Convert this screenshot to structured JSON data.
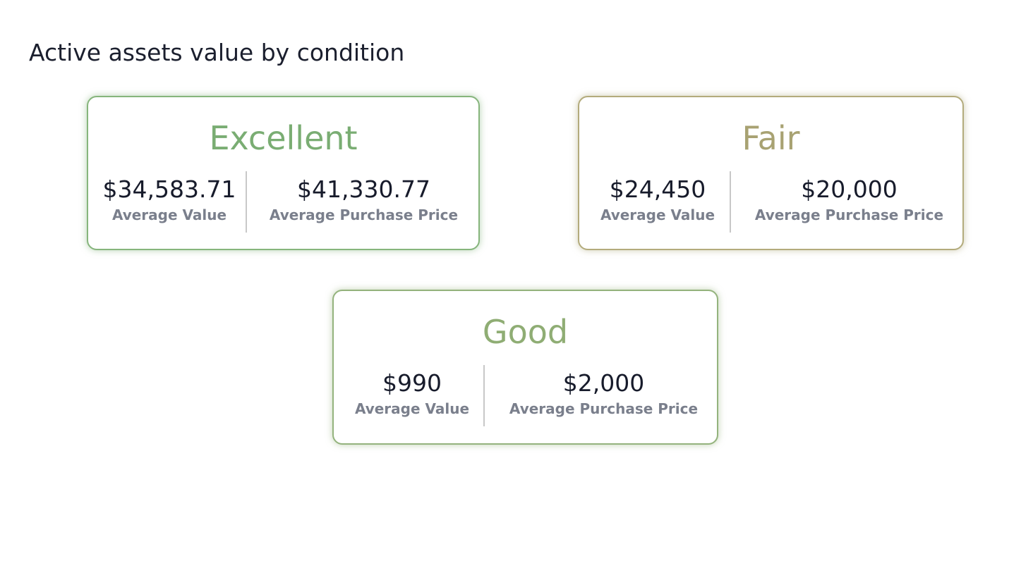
{
  "page": {
    "title": "Active assets value by condition"
  },
  "cards": [
    {
      "condition": "Excellent",
      "color": "#7aad73",
      "border_color": "#86b57c",
      "average_value": "$34,583.71",
      "average_value_label": "Average Value",
      "average_purchase_price": "$41,330.77",
      "average_purchase_price_label": "Average Purchase Price"
    },
    {
      "condition": "Fair",
      "color": "#a8a272",
      "border_color": "#b3ab7c",
      "average_value": "$24,450",
      "average_value_label": "Average Value",
      "average_purchase_price": "$20,000",
      "average_purchase_price_label": "Average Purchase Price"
    },
    {
      "condition": "Good",
      "color": "#8fad74",
      "border_color": "#94b37d",
      "average_value": "$990",
      "average_value_label": "Average Value",
      "average_purchase_price": "$2,000",
      "average_purchase_price_label": "Average Purchase Price"
    }
  ]
}
